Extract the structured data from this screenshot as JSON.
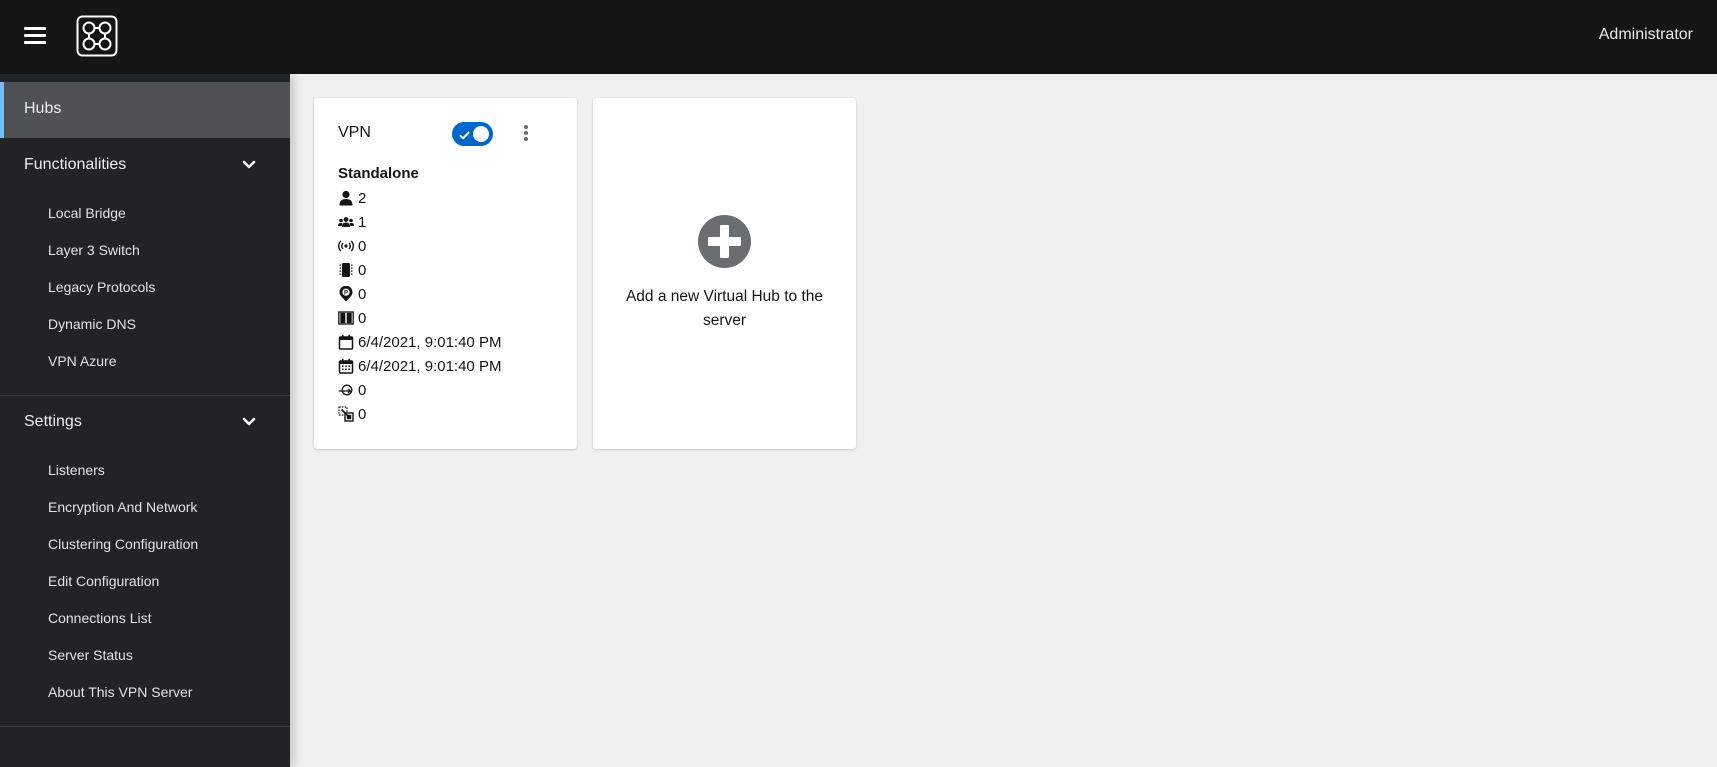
{
  "header": {
    "menu_icon": "hamburger-icon",
    "logo_icon": "hub-network-logo-icon",
    "user_label": "Administrator"
  },
  "sidebar": {
    "active_item": {
      "label": "Hubs"
    },
    "groups": [
      {
        "label": "Functionalities",
        "expanded": true,
        "items": [
          {
            "label": "Local Bridge"
          },
          {
            "label": "Layer 3 Switch"
          },
          {
            "label": "Legacy Protocols"
          },
          {
            "label": "Dynamic DNS"
          },
          {
            "label": "VPN Azure"
          }
        ]
      },
      {
        "label": "Settings",
        "expanded": true,
        "items": [
          {
            "label": "Listeners"
          },
          {
            "label": "Encryption And Network"
          },
          {
            "label": "Clustering Configuration"
          },
          {
            "label": "Edit Configuration"
          },
          {
            "label": "Connections List"
          },
          {
            "label": "Server Status"
          },
          {
            "label": "About This VPN Server"
          }
        ]
      }
    ]
  },
  "hubs": [
    {
      "name": "VPN",
      "enabled": true,
      "type": "Standalone",
      "stats": [
        {
          "icon": "user-icon",
          "value": "2"
        },
        {
          "icon": "users-icon",
          "value": "1"
        },
        {
          "icon": "broadcast-icon",
          "value": "0"
        },
        {
          "icon": "memory-chip-icon",
          "value": "0"
        },
        {
          "icon": "map-marker-p-icon",
          "value": "0"
        },
        {
          "icon": "book-open-icon",
          "value": "0"
        },
        {
          "icon": "calendar-icon",
          "value": "6/4/2021, 9:01:40 PM"
        },
        {
          "icon": "calendar-alt-icon",
          "value": "6/4/2021, 9:01:40 PM"
        },
        {
          "icon": "login-sync-icon",
          "value": "0"
        },
        {
          "icon": "select-arrow-icon",
          "value": "0"
        }
      ]
    }
  ],
  "add_card": {
    "icon": "plus-circle-icon",
    "label": "Add a new Virtual Hub to the server"
  },
  "colors": {
    "header_bg": "#151515",
    "sidebar_bg": "#212427",
    "active_bg": "#4f5255",
    "active_accent": "#73bcf7",
    "toggle_on": "#0066cc",
    "page_bg": "#f0f0f0"
  }
}
